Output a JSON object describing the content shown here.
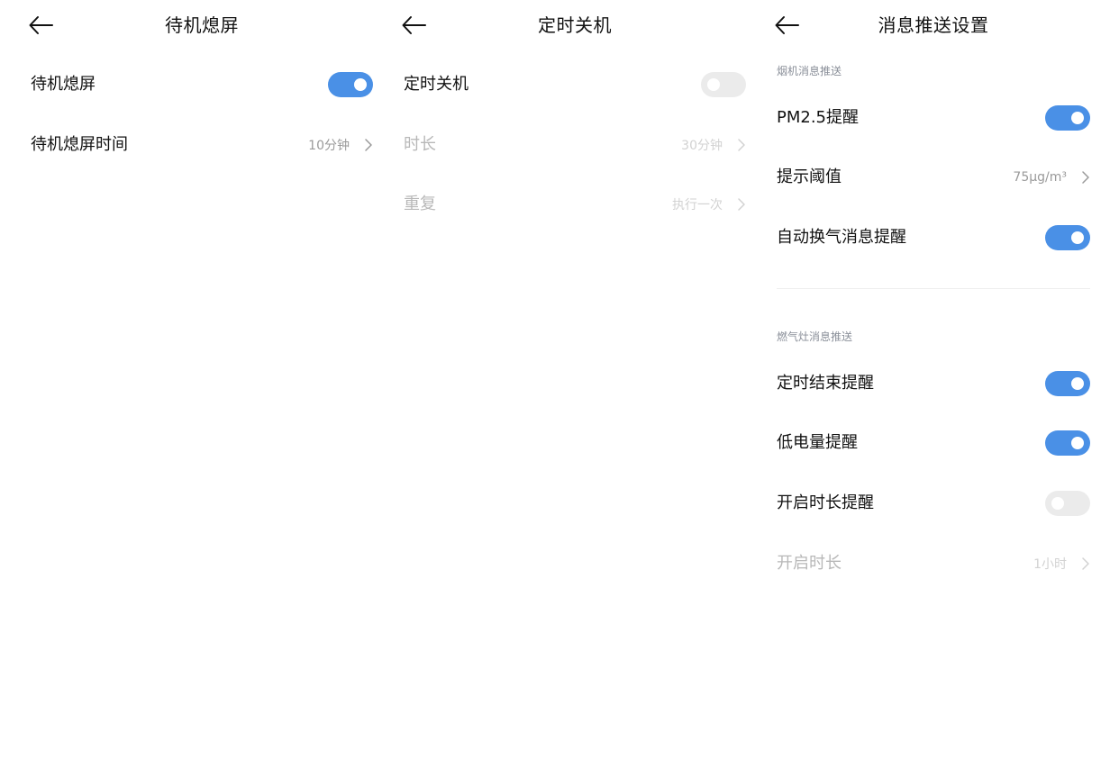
{
  "screens": [
    {
      "title": "待机熄屏",
      "rows": [
        {
          "label": "待机熄屏",
          "toggle": "on"
        },
        {
          "label": "待机熄屏时间",
          "value": "10分钟"
        }
      ]
    },
    {
      "title": "定时关机",
      "rows": [
        {
          "label": "定时关机",
          "toggle": "off"
        },
        {
          "label": "时长",
          "value": "30分钟",
          "disabled": true
        },
        {
          "label": "重复",
          "value": "执行一次",
          "disabled": true
        }
      ]
    },
    {
      "title": "消息推送设置",
      "sections": [
        {
          "title": "烟机消息推送",
          "rows": [
            {
              "label": "PM2.5提醒",
              "toggle": "on"
            },
            {
              "label": "提示阈值",
              "value": "75μg/m³"
            },
            {
              "label": "自动换气消息提醒",
              "toggle": "on"
            }
          ]
        },
        {
          "title": "燃气灶消息推送",
          "rows": [
            {
              "label": "定时结束提醒",
              "toggle": "on"
            },
            {
              "label": "低电量提醒",
              "toggle": "on"
            },
            {
              "label": "开启时长提醒",
              "toggle": "off"
            },
            {
              "label": "开启时长",
              "value": "1小时",
              "disabled": true
            }
          ]
        }
      ]
    }
  ],
  "colors": {
    "toggle_on": "#4a90e6",
    "toggle_off": "#ebebeb",
    "text_primary": "#111111",
    "text_secondary": "#9a9a9a",
    "text_disabled": "#b8b8b8",
    "section_title": "#8a8f99"
  },
  "icons": {
    "back": "arrow-left-icon",
    "chevron": "chevron-right-icon"
  }
}
